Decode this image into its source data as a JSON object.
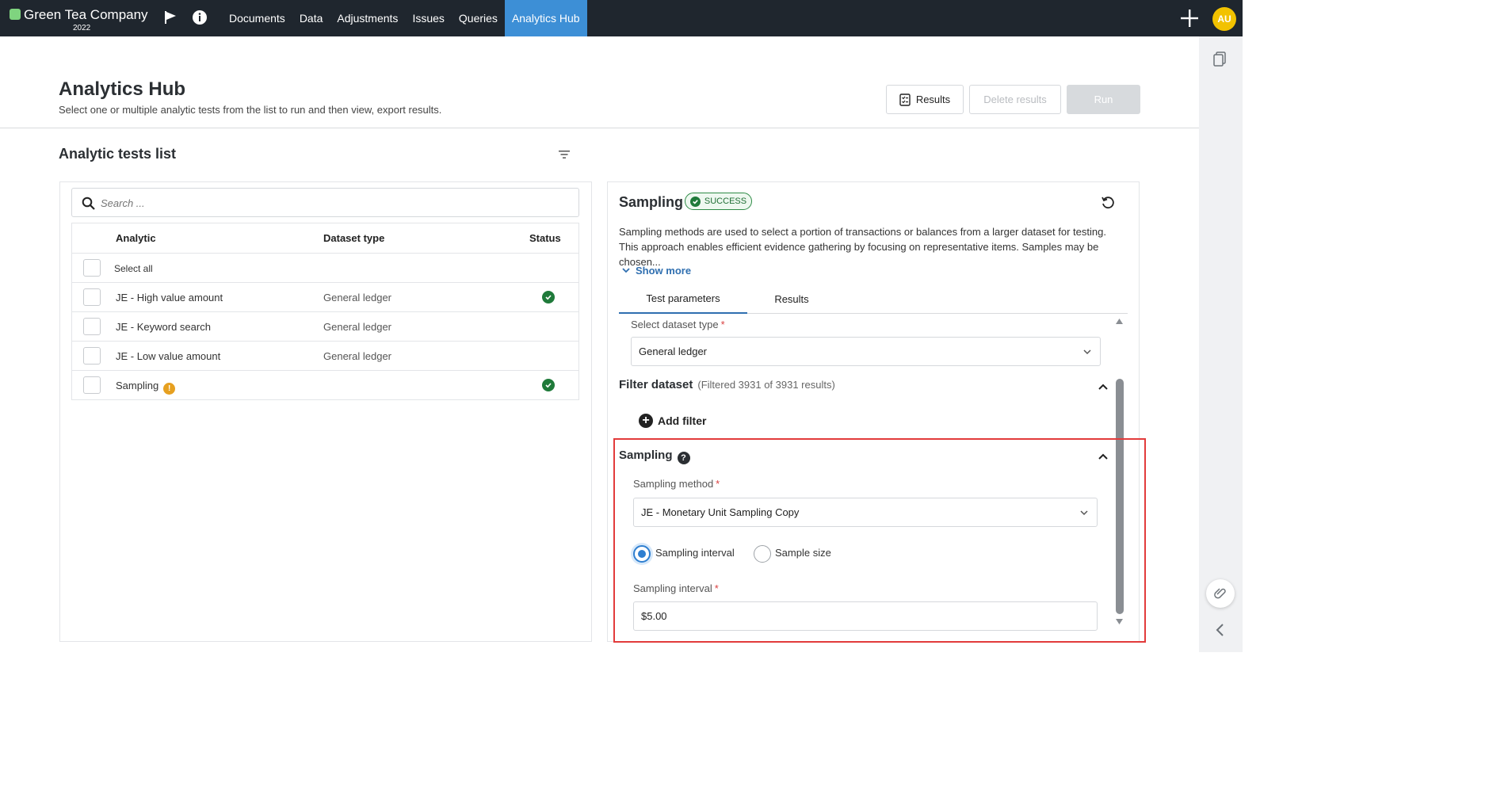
{
  "topbar": {
    "company": "Green Tea Company",
    "year": "2022",
    "nav": [
      "Documents",
      "Data",
      "Adjustments",
      "Issues",
      "Queries",
      "Analytics Hub"
    ],
    "active_nav": "Analytics Hub",
    "avatar_initials": "AU",
    "icons": [
      "flag-icon",
      "info-icon",
      "plus-icon"
    ]
  },
  "header": {
    "title": "Analytics Hub",
    "subtitle": "Select one or multiple analytic tests from the list to run and then view, export results.",
    "results_btn": "Results",
    "delete_btn": "Delete results",
    "run_btn": "Run"
  },
  "list": {
    "title": "Analytic tests list",
    "search_placeholder": "Search ...",
    "columns": {
      "analytic": "Analytic",
      "dataset": "Dataset type",
      "status": "Status"
    },
    "select_all": "Select all",
    "rows": [
      {
        "name": "JE - High value amount",
        "dataset": "General ledger",
        "status": "success"
      },
      {
        "name": "JE - Keyword search",
        "dataset": "General ledger",
        "status": ""
      },
      {
        "name": "JE - Low value amount",
        "dataset": "General ledger",
        "status": ""
      },
      {
        "name": "Sampling",
        "dataset": "",
        "status": "success",
        "warning": true
      }
    ]
  },
  "detail": {
    "title": "Sampling",
    "badge": "SUCCESS",
    "description": "Sampling methods are used to select a portion of transactions or balances from a larger dataset for testing. This approach enables efficient evidence gathering by focusing on representative items. Samples may be chosen...",
    "show_more": "Show more",
    "tabs": [
      "Test parameters",
      "Results"
    ],
    "dataset_label": "Select dataset type",
    "dataset_value": "General ledger",
    "filter_title": "Filter dataset",
    "filter_note": "(Filtered 3931 of 3931 results)",
    "add_filter": "Add filter",
    "sampling_title": "Sampling",
    "method_label": "Sampling method",
    "method_value": "JE - Monetary Unit Sampling Copy",
    "radio_interval": "Sampling interval",
    "radio_size": "Sample size",
    "radio_selected": "Sampling interval",
    "interval_label": "Sampling interval",
    "interval_value": "$5.00",
    "required_mark": "*"
  },
  "colors": {
    "topbar": "#1f262e",
    "accent": "#3d8fd6",
    "success": "#1f7a3a",
    "warning": "#e6a020",
    "highlight": "#e23b3b"
  }
}
